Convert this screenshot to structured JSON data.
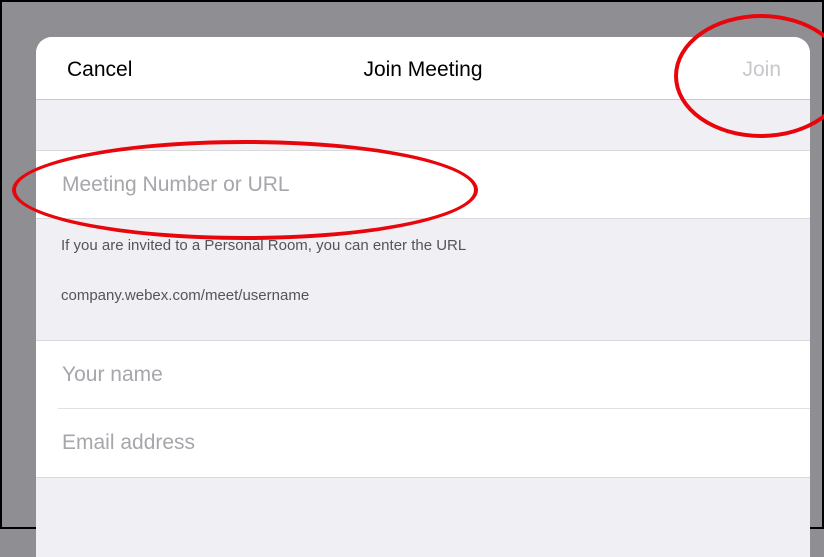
{
  "navbar": {
    "cancel_label": "Cancel",
    "title": "Join Meeting",
    "join_label": "Join"
  },
  "meeting": {
    "placeholder": "Meeting Number or URL",
    "hint_line1": "If you are invited to a Personal Room, you can enter the URL",
    "hint_line2": "company.webex.com/meet/username"
  },
  "user": {
    "name_placeholder": "Your name",
    "email_placeholder": "Email address"
  },
  "colors": {
    "annotation_ring": "#e8050b",
    "join_disabled": "#c7c7cc",
    "backdrop": "#8e8e93"
  }
}
